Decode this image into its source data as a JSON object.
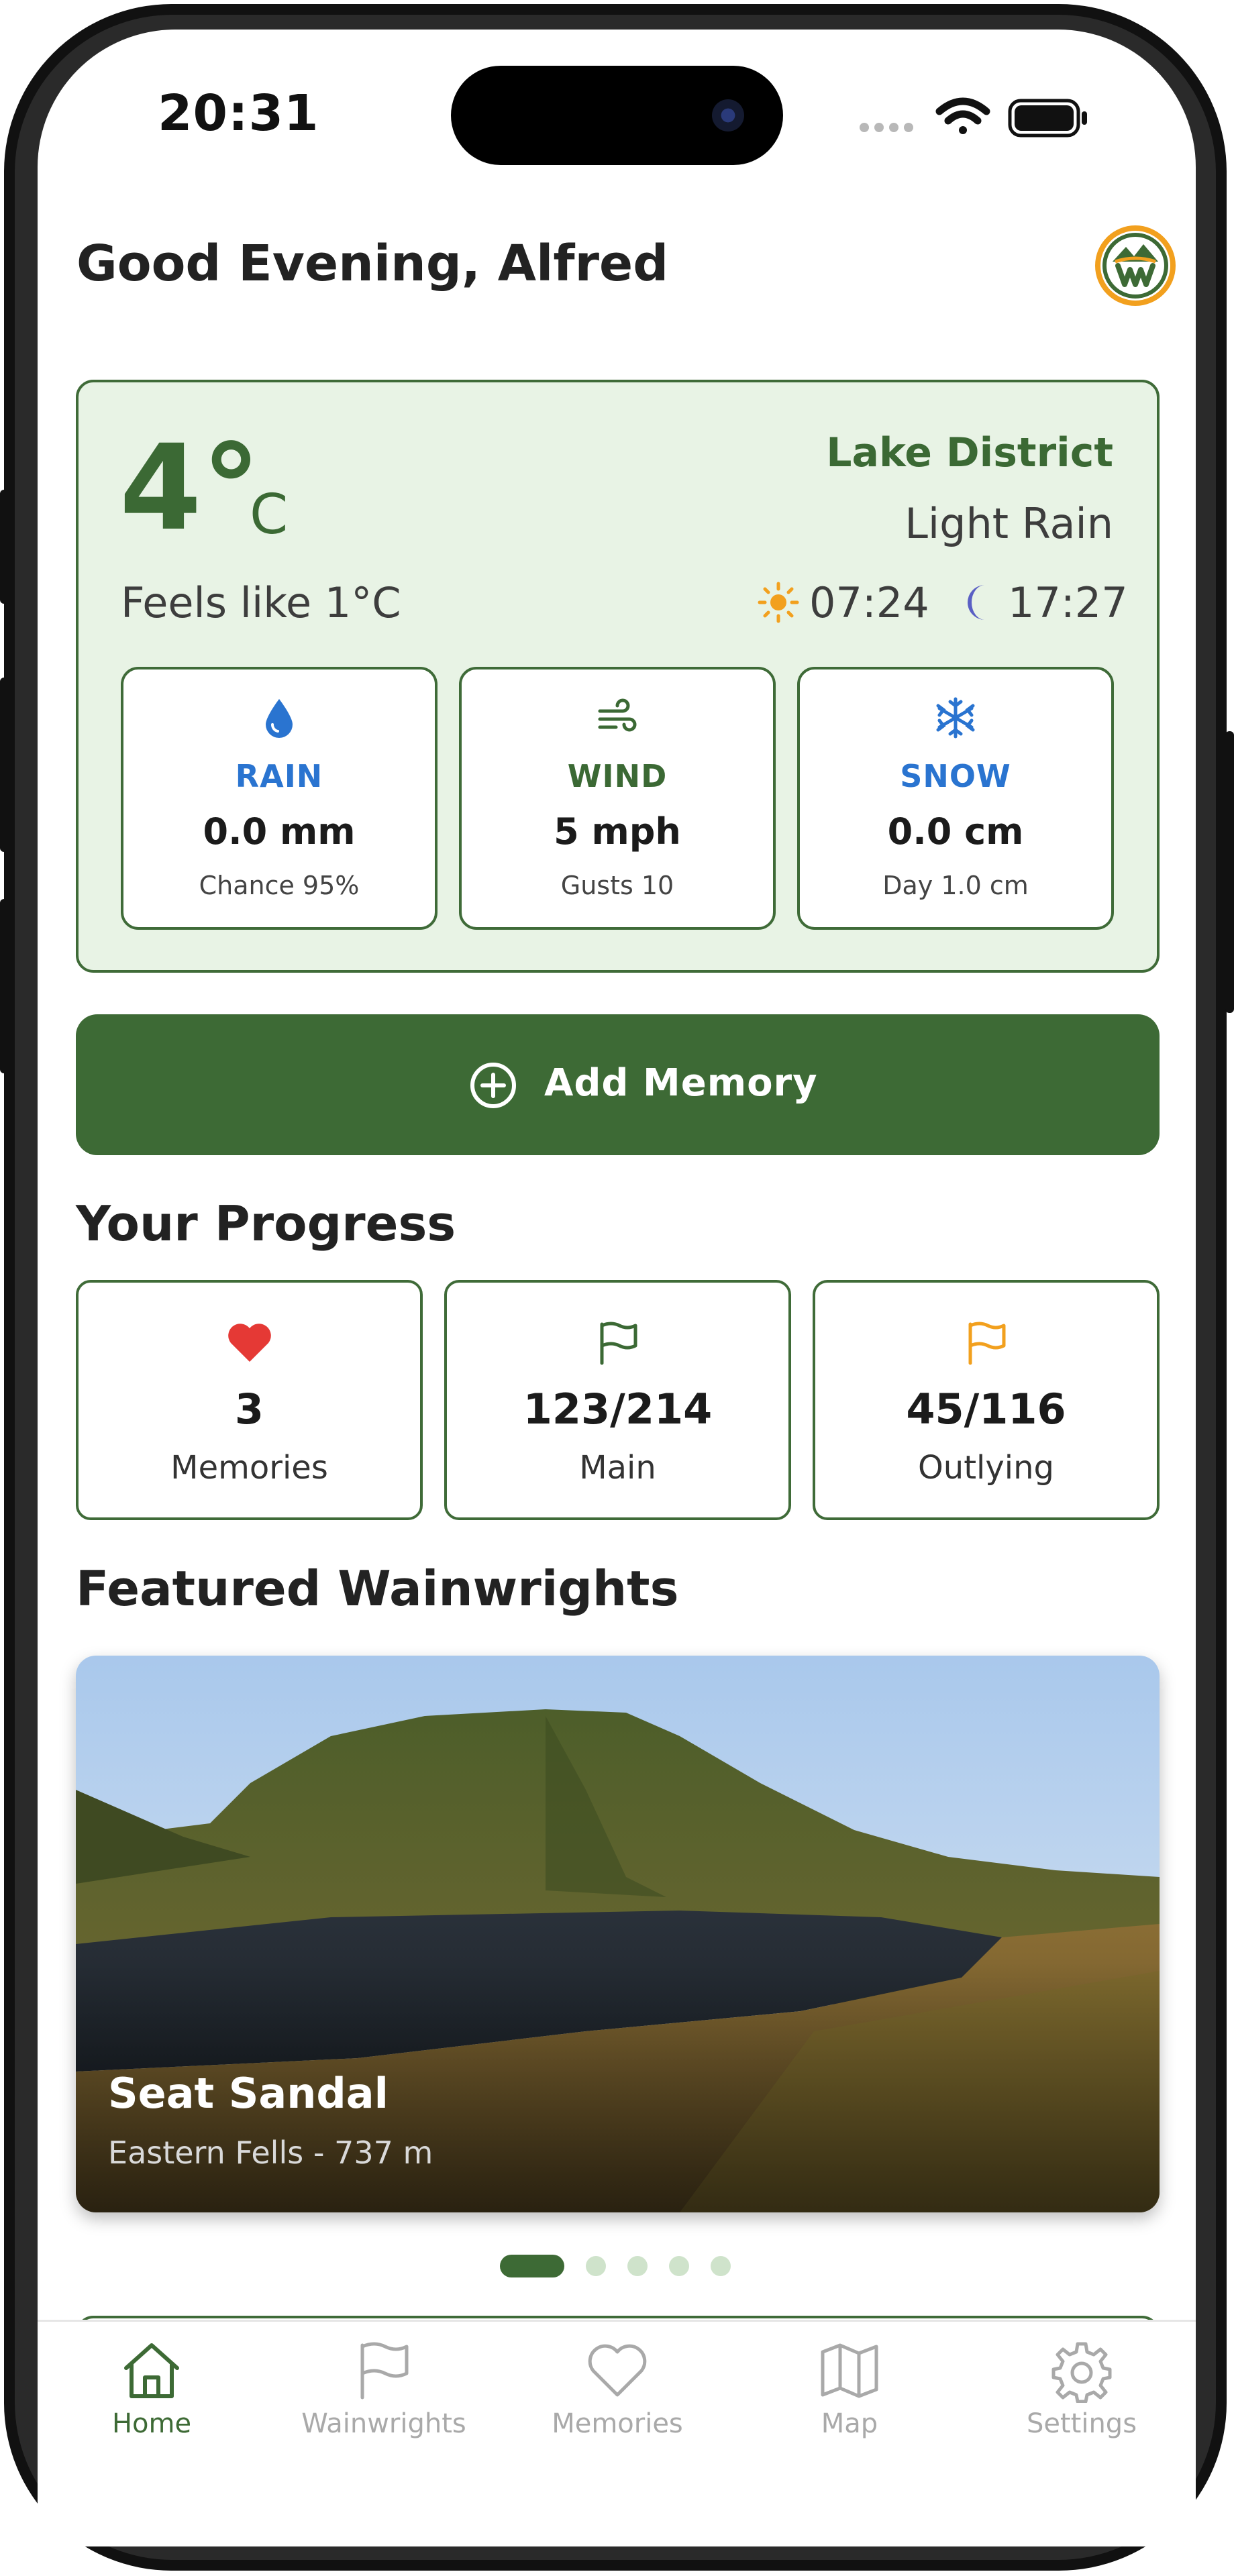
{
  "status_bar": {
    "time": "20:31"
  },
  "header": {
    "greeting": "Good Evening, Alfred",
    "logo_icon": "wainwrights-logo-icon"
  },
  "weather": {
    "temperature": "4°",
    "unit": "C",
    "location": "Lake District",
    "condition": "Light Rain",
    "feels_like": "Feels like 1°C",
    "sunrise": "07:24",
    "sunset": "17:27",
    "metrics": [
      {
        "label": "RAIN",
        "value": "0.0 mm",
        "sub": "Chance 95%",
        "icon": "raindrop-icon",
        "color": "#2a74d0"
      },
      {
        "label": "WIND",
        "value": "5 mph",
        "sub": "Gusts 10",
        "icon": "wind-icon",
        "color": "#3b6934"
      },
      {
        "label": "SNOW",
        "value": "0.0 cm",
        "sub": "Day 1.0 cm",
        "icon": "snowflake-icon",
        "color": "#2a74d0"
      }
    ]
  },
  "actions": {
    "add_memory_label": "Add Memory"
  },
  "progress": {
    "title": "Your Progress",
    "cards": [
      {
        "value": "3",
        "label": "Memories",
        "icon": "heart-icon",
        "color": "#e53935"
      },
      {
        "value": "123/214",
        "label": "Main",
        "icon": "flag-icon",
        "color": "#3b6934"
      },
      {
        "value": "45/116",
        "label": "Outlying",
        "icon": "flag-icon",
        "color": "#f2a01e"
      }
    ]
  },
  "featured": {
    "title": "Featured Wainwrights",
    "name": "Seat Sandal",
    "subtitle": "Eastern Fells - 737 m",
    "carousel": {
      "count": 5,
      "active_index": 0
    }
  },
  "tabbar": {
    "items": [
      {
        "label": "Home",
        "icon": "home-icon",
        "active": true
      },
      {
        "label": "Wainwrights",
        "icon": "flag-icon",
        "active": false
      },
      {
        "label": "Memories",
        "icon": "heart-icon",
        "active": false
      },
      {
        "label": "Map",
        "icon": "map-icon",
        "active": false
      },
      {
        "label": "Settings",
        "icon": "gear-icon",
        "active": false
      }
    ]
  },
  "colors": {
    "brand_green": "#3d6a35",
    "card_tint": "#e8f3e5",
    "accent_orange": "#f2a01e",
    "accent_blue": "#2a74d0",
    "heart_red": "#e53935"
  }
}
